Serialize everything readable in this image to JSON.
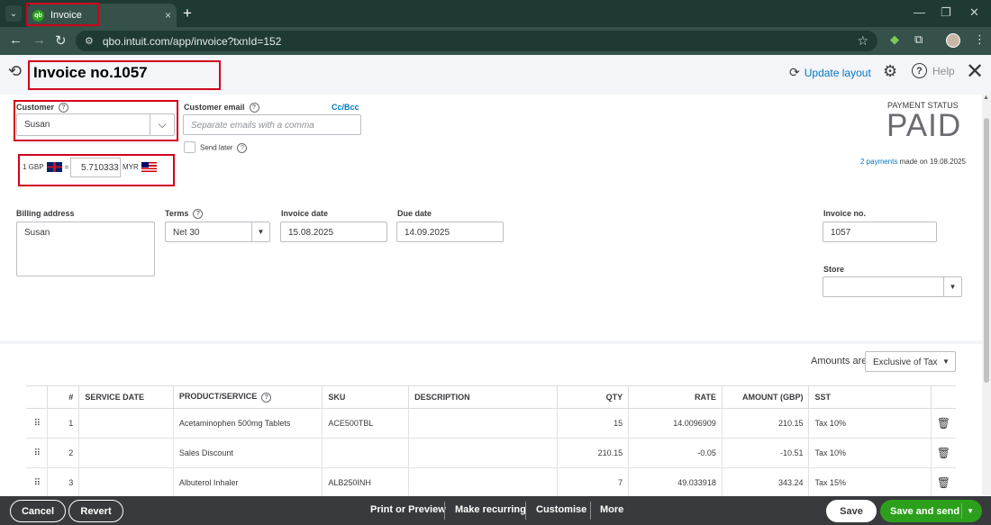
{
  "browser": {
    "tab_title": "Invoice",
    "favicon": "qb",
    "tab_close": "×",
    "new_tab": "+",
    "url": "qbo.intuit.com/app/invoice?txnId=152"
  },
  "header": {
    "title": "Invoice no.1057",
    "update_layout": "Update layout",
    "help": "Help"
  },
  "customer": {
    "label": "Customer",
    "value": "Susan"
  },
  "customer_email": {
    "label": "Customer email",
    "placeholder": "Separate emails with a comma",
    "cc_bcc": "Cc/Bcc",
    "send_later": "Send later"
  },
  "exchange_rate": {
    "base": "1 GBP",
    "equals": "=",
    "rate": "5.710333",
    "quote": "MYR"
  },
  "payment_status": {
    "label": "PAYMENT STATUS",
    "value": "PAID",
    "payments_link": "2 payments",
    "payments_suffix": "made on 19.08.2025"
  },
  "billing_address": {
    "label": "Billing address",
    "value": "Susan"
  },
  "terms": {
    "label": "Terms",
    "value": "Net 30"
  },
  "invoice_date": {
    "label": "Invoice date",
    "value": "15.08.2025"
  },
  "due_date": {
    "label": "Due date",
    "value": "14.09.2025"
  },
  "invoice_no": {
    "label": "Invoice no.",
    "value": "1057"
  },
  "store": {
    "label": "Store",
    "value": ""
  },
  "amounts_are": {
    "label": "Amounts are",
    "value": "Exclusive of Tax"
  },
  "table": {
    "headers": {
      "num": "#",
      "service_date": "SERVICE DATE",
      "product": "PRODUCT/SERVICE",
      "sku": "SKU",
      "description": "DESCRIPTION",
      "qty": "QTY",
      "rate": "RATE",
      "amount": "AMOUNT (GBP)",
      "tax": "SST"
    },
    "rows": [
      {
        "num": "1",
        "service_date": "",
        "product": "Acetaminophen 500mg Tablets",
        "sku": "ACE500TBL",
        "description": "",
        "qty": "15",
        "rate": "14.0096909",
        "amount": "210.15",
        "tax": "Tax 10%"
      },
      {
        "num": "2",
        "service_date": "",
        "product": "Sales Discount",
        "sku": "",
        "description": "",
        "qty": "210.15",
        "rate": "-0.05",
        "amount": "-10.51",
        "tax": "Tax 10%"
      },
      {
        "num": "3",
        "service_date": "",
        "product": "Albuterol Inhaler",
        "sku": "ALB250INH",
        "description": "",
        "qty": "7",
        "rate": "49.033918",
        "amount": "343.24",
        "tax": "Tax 15%"
      }
    ]
  },
  "footer": {
    "cancel": "Cancel",
    "revert": "Revert",
    "print_preview": "Print or Preview",
    "make_recurring": "Make recurring",
    "customise": "Customise",
    "more": "More",
    "save": "Save",
    "save_and_send": "Save and send"
  },
  "colors": {
    "brand_green": "#2ca01c",
    "link_blue": "#0077c5",
    "footer_bg": "#393a3d",
    "highlight_red": "#d0021b"
  }
}
